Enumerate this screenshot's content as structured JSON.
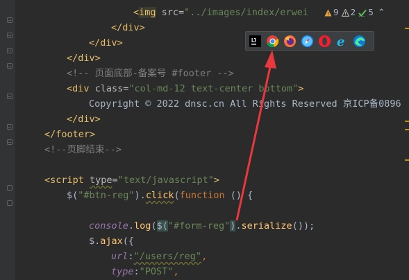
{
  "inspections": {
    "warnings": "9",
    "weak_warnings": "2",
    "typos": "5",
    "warning_color": "#e8a33d",
    "weak_color": "#b0b0b0",
    "typo_color": "#5fb85f"
  },
  "code_lines": [
    {
      "parts": [
        {
          "t": "<",
          "c": "tag"
        },
        {
          "t": "img",
          "c": "tag hl-tag"
        },
        {
          "t": " src=",
          "c": "attr"
        },
        {
          "t": "\"../images/index/erwei",
          "c": "str"
        }
      ]
    },
    {
      "parts": [
        {
          "t": "</div>",
          "c": "tag"
        }
      ]
    },
    {
      "parts": [
        {
          "t": "</div>",
          "c": "tag"
        }
      ]
    },
    {
      "parts": [
        {
          "t": "</div>",
          "c": "tag"
        }
      ]
    },
    {
      "parts": [
        {
          "t": "<!-- 页面底部-备案号 #footer -->",
          "c": "comment"
        }
      ]
    },
    {
      "parts": [
        {
          "t": "<div ",
          "c": "tag"
        },
        {
          "t": "class=",
          "c": "attr"
        },
        {
          "t": "\"col-md-12 text-center bottom\"",
          "c": "str"
        },
        {
          "t": ">",
          "c": "tag"
        }
      ]
    },
    {
      "parts": [
        {
          "t": "Copyright © 2022 dnsc.cn All Rights Reserved 京ICP备0896",
          "c": "text"
        }
      ]
    },
    {
      "parts": [
        {
          "t": "</div>",
          "c": "tag"
        }
      ]
    },
    {
      "parts": [
        {
          "t": "</footer>",
          "c": "tag"
        }
      ]
    },
    {
      "parts": [
        {
          "t": "<!--页脚结束-->",
          "c": "comment"
        }
      ]
    },
    {
      "parts": []
    },
    {
      "parts": [
        {
          "t": "<script ",
          "c": "tag"
        },
        {
          "t": "type",
          "c": "attr underline-wave"
        },
        {
          "t": "=",
          "c": "attr"
        },
        {
          "t": "\"text/javascript\"",
          "c": "str"
        },
        {
          "t": ">",
          "c": "tag"
        }
      ]
    },
    {
      "parts": [
        {
          "t": "$(",
          "c": "plain"
        },
        {
          "t": "\"#btn-reg\"",
          "c": "str"
        },
        {
          "t": ").",
          "c": "plain"
        },
        {
          "t": "click",
          "c": "fn underline-wave"
        },
        {
          "t": "(",
          "c": "plain"
        },
        {
          "t": "function",
          "c": "kw"
        },
        {
          "t": " () {",
          "c": "plain"
        }
      ]
    },
    {
      "parts": []
    },
    {
      "parts": [
        {
          "t": "console",
          "c": "ident"
        },
        {
          "t": ".",
          "c": "plain"
        },
        {
          "t": "log",
          "c": "fn"
        },
        {
          "t": "(",
          "c": "plain"
        },
        {
          "t": "$(",
          "c": "plain hl-paren"
        },
        {
          "t": "\"#form-reg\"",
          "c": "str"
        },
        {
          "t": ")",
          "c": "plain hl-paren"
        },
        {
          "t": ".",
          "c": "plain"
        },
        {
          "t": "serialize",
          "c": "fn"
        },
        {
          "t": "());",
          "c": "plain"
        }
      ]
    },
    {
      "parts": [
        {
          "t": "$.",
          "c": "plain"
        },
        {
          "t": "ajax",
          "c": "fn"
        },
        {
          "t": "({",
          "c": "plain"
        }
      ]
    },
    {
      "parts": [
        {
          "t": "url",
          "c": "ident"
        },
        {
          "t": ":",
          "c": "plain"
        },
        {
          "t": "\"/users/reg\"",
          "c": "str underline-wave"
        },
        {
          "t": ",",
          "c": "kw"
        }
      ]
    },
    {
      "parts": [
        {
          "t": "type",
          "c": "ident"
        },
        {
          "t": ":",
          "c": "plain"
        },
        {
          "t": "\"POST\"",
          "c": "str"
        },
        {
          "t": ",",
          "c": "kw"
        }
      ]
    }
  ],
  "browsers": [
    {
      "name": "IntelliJ",
      "icon": "intellij-icon"
    },
    {
      "name": "Chrome",
      "icon": "chrome-icon"
    },
    {
      "name": "Firefox",
      "icon": "firefox-icon"
    },
    {
      "name": "Safari",
      "icon": "safari-icon"
    },
    {
      "name": "Opera",
      "icon": "opera-icon"
    },
    {
      "name": "Internet Explorer",
      "icon": "ie-icon"
    },
    {
      "name": "Edge",
      "icon": "edge-icon"
    }
  ],
  "annotation": {
    "color": "#e8383d"
  }
}
